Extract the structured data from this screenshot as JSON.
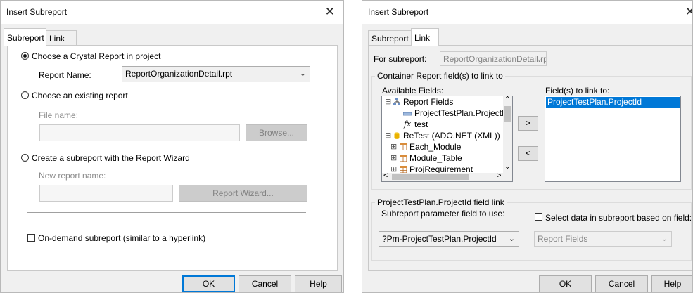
{
  "left": {
    "title": "Insert Subreport",
    "close": "✕",
    "tabs": [
      "Subreport",
      "Link"
    ],
    "choose_crystal_label": "Choose a Crystal Report in project",
    "report_name_label": "Report Name:",
    "report_name_value": "ReportOrganizationDetail.rpt",
    "choose_existing_label": "Choose an existing report",
    "file_name_label": "File name:",
    "browse_label": "Browse...",
    "wizard_label": "Create a subreport with the Report Wizard",
    "new_report_name_label": "New report name:",
    "report_wizard_label": "Report Wizard...",
    "on_demand_label": "On-demand subreport (similar to a hyperlink)",
    "ok": "OK",
    "cancel": "Cancel",
    "help": "Help"
  },
  "right": {
    "title": "Insert Subreport",
    "close": "✕",
    "tabs": [
      "Subreport",
      "Link"
    ],
    "for_subreport_label": "For subreport:",
    "for_subreport_value": "ReportOrganizationDetail.rp",
    "container_group_title": "Container Report field(s) to link to",
    "available_fields_label": "Available Fields:",
    "fields_to_link_label": "Field(s) to link to:",
    "tree": [
      {
        "label": "Report Fields",
        "expander": "⊟",
        "icon": "report-fields-icon"
      },
      {
        "label": "ProjectTestPlan.ProjectId",
        "icon": "parameter-field-icon"
      },
      {
        "label": "test",
        "icon": "formula-icon",
        "icon_text": "fx"
      },
      {
        "label": "ReTest (ADO.NET (XML))",
        "expander": "⊟",
        "icon": "database-icon"
      },
      {
        "label": "Each_Module",
        "expander": "⊞",
        "icon": "table-icon"
      },
      {
        "label": "Module_Table",
        "expander": "⊞",
        "icon": "table-icon"
      },
      {
        "label": "ProjRequirement",
        "expander": "⊞",
        "icon": "table-icon"
      }
    ],
    "linked_fields": [
      "ProjectTestPlan.ProjectId"
    ],
    "add_button": ">",
    "remove_button": "<",
    "field_link_group_title": "ProjectTestPlan.ProjectId field link",
    "subreport_param_label": "Subreport parameter field to use:",
    "select_data_label": "Select data in subreport based on field:",
    "param_value": "?Pm-ProjectTestPlan.ProjectId",
    "report_fields_value": "Report Fields",
    "ok": "OK",
    "cancel": "Cancel",
    "help": "Help"
  }
}
